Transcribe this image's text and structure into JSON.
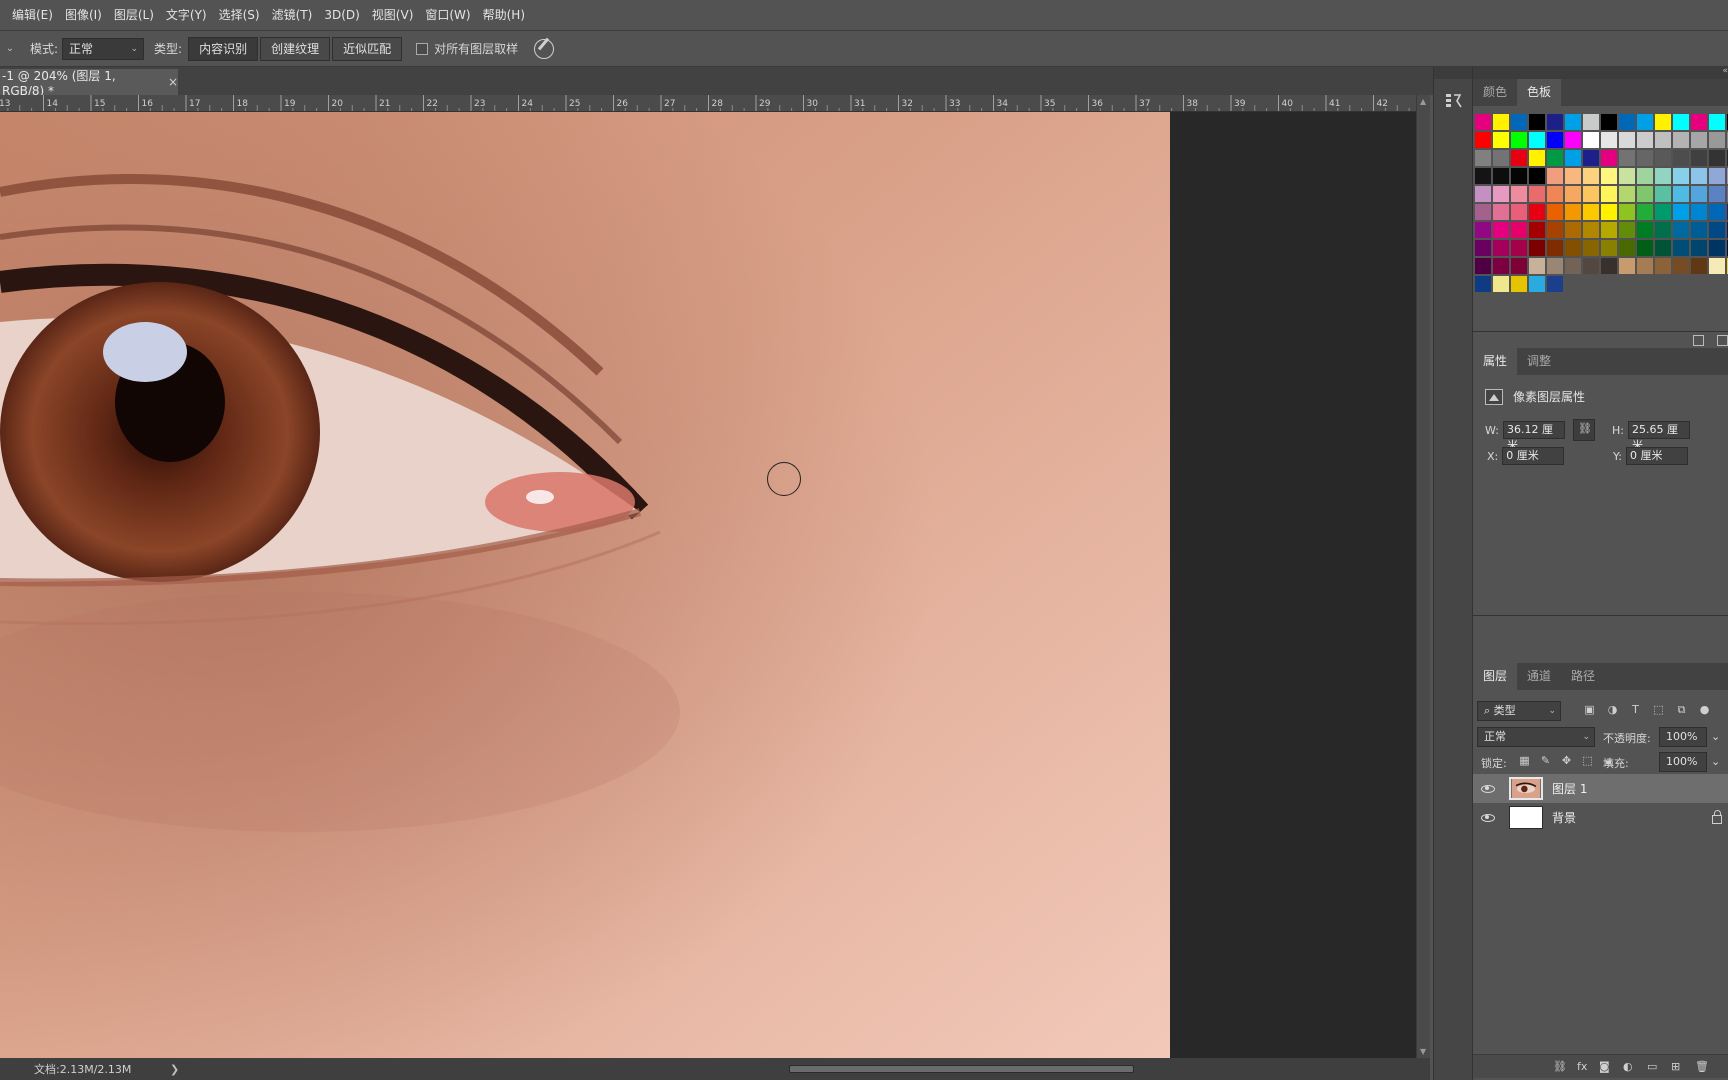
{
  "menu": [
    "编辑(E)",
    "图像(I)",
    "图层(L)",
    "文字(Y)",
    "选择(S)",
    "滤镜(T)",
    "3D(D)",
    "视图(V)",
    "窗口(W)",
    "帮助(H)"
  ],
  "options": {
    "mode_label": "模式:",
    "mode_value": "正常",
    "type_label": "类型:",
    "type_options": [
      "内容识别",
      "创建纹理",
      "近似匹配"
    ],
    "sample_all_label": "对所有图层取样"
  },
  "doc_tab": {
    "title": "-1 @ 204% (图层 1, RGB/8) *",
    "close": "×"
  },
  "ruler_ticks": [
    "13",
    "14",
    "15",
    "16",
    "17",
    "18",
    "19",
    "20",
    "21",
    "22",
    "23",
    "24",
    "25",
    "26",
    "27",
    "28",
    "29",
    "30",
    "31",
    "32",
    "33",
    "34",
    "35",
    "36",
    "37",
    "38",
    "39",
    "40",
    "41",
    "42"
  ],
  "status": {
    "doc": "文档:2.13M/2.13M",
    "arrow": "❯"
  },
  "swatches_panel": {
    "tabs": [
      "颜色",
      "色板"
    ],
    "active": 1,
    "colors": [
      "#e6007e",
      "#fff100",
      "#0068b7",
      "#000000",
      "#1d2088",
      "#00a0e9",
      "#c9caca",
      "#000000",
      "#0068b7",
      "#00a0e9",
      "#fff100",
      "#00ffff",
      "#e6007e",
      "#00ffff",
      "#000000",
      "#ffffff",
      "#ff0000",
      "#ffff00",
      "#00ff00",
      "#00ffff",
      "#0000ff",
      "#ff00ff",
      "#ffffff",
      "#e6e6e6",
      "#d9d9d9",
      "#cccccc",
      "#bfbfbf",
      "#b3b3b3",
      "#a6a6a6",
      "#999999",
      "#8c8c8c",
      "#808080",
      "#808080",
      "#737373",
      "#e60012",
      "#fff100",
      "#009944",
      "#00a0e9",
      "#1d2088",
      "#e4007f",
      "#737373",
      "#666666",
      "#595959",
      "#4d4d4d",
      "#404040",
      "#333333",
      "#262626",
      "#1a1a1a",
      "#141414",
      "#0d0d0d",
      "#050505",
      "#000000",
      "#f19e7f",
      "#f7b77f",
      "#fcd27f",
      "#fff67f",
      "#c9e29f",
      "#9fd49e",
      "#91d4c2",
      "#87d0ea",
      "#8ec4ea",
      "#8fa8d8",
      "#9c95c9",
      "#af8fc3",
      "#c490c1",
      "#e79ac1",
      "#ef8b9f",
      "#ea6b6b",
      "#f08656",
      "#f6a860",
      "#fbc660",
      "#fff45a",
      "#b4d66e",
      "#7fc66c",
      "#5bbfa2",
      "#4fbae3",
      "#54a5de",
      "#5b83c4",
      "#7268b0",
      "#8c64ab",
      "#a5618e",
      "#e26f94",
      "#e95f7a",
      "#e60012",
      "#eb6100",
      "#f39800",
      "#fcc800",
      "#fff100",
      "#8fc31f",
      "#22ac38",
      "#009b6b",
      "#00a0e9",
      "#0086d1",
      "#0068b7",
      "#1d2088",
      "#601986",
      "#920783",
      "#e4007f",
      "#e5006a",
      "#a40000",
      "#a84200",
      "#ad6a00",
      "#b28700",
      "#b5a900",
      "#638c0b",
      "#007d23",
      "#006f4c",
      "#0069a0",
      "#005c94",
      "#004986",
      "#101763",
      "#440062",
      "#6a005f",
      "#a4005b",
      "#a5004a",
      "#7d0000",
      "#7f2d00",
      "#834f00",
      "#876500",
      "#897f00",
      "#496a00",
      "#005e17",
      "#005337",
      "#004d76",
      "#00456e",
      "#003462",
      "#000e48",
      "#2f0047",
      "#4f0045",
      "#7c0041",
      "#7d0036",
      "#c7b299",
      "#998675",
      "#736357",
      "#534741",
      "#37302d",
      "#c69c6d",
      "#a67c52",
      "#8c6239",
      "#754c24",
      "#603813",
      "#f6eab6",
      "#fcd32f",
      "#31a4d6",
      "#0d3b84",
      "#f0e68c",
      "#e6c300",
      "#29abe2",
      "#1b3f8b"
    ]
  },
  "properties_panel": {
    "tabs": [
      "属性",
      "调整"
    ],
    "active": 0,
    "title": "像素图层属性",
    "w_label": "W:",
    "w_value": "36.12 厘米",
    "h_label": "H:",
    "h_value": "25.65 厘米",
    "x_label": "X:",
    "x_value": "0 厘米",
    "y_label": "Y:",
    "y_value": "0 厘米"
  },
  "layers_panel": {
    "tabs": [
      "图层",
      "通道",
      "路径"
    ],
    "active": 0,
    "filter_value": "⌕ 类型",
    "blend_value": "正常",
    "opacity_label": "不透明度:",
    "opacity_value": "100%",
    "lock_label": "锁定:",
    "fill_label": "填充:",
    "fill_value": "100%",
    "layers": [
      {
        "name": "图层 1",
        "selected": true
      },
      {
        "name": "背景",
        "selected": false
      }
    ]
  }
}
